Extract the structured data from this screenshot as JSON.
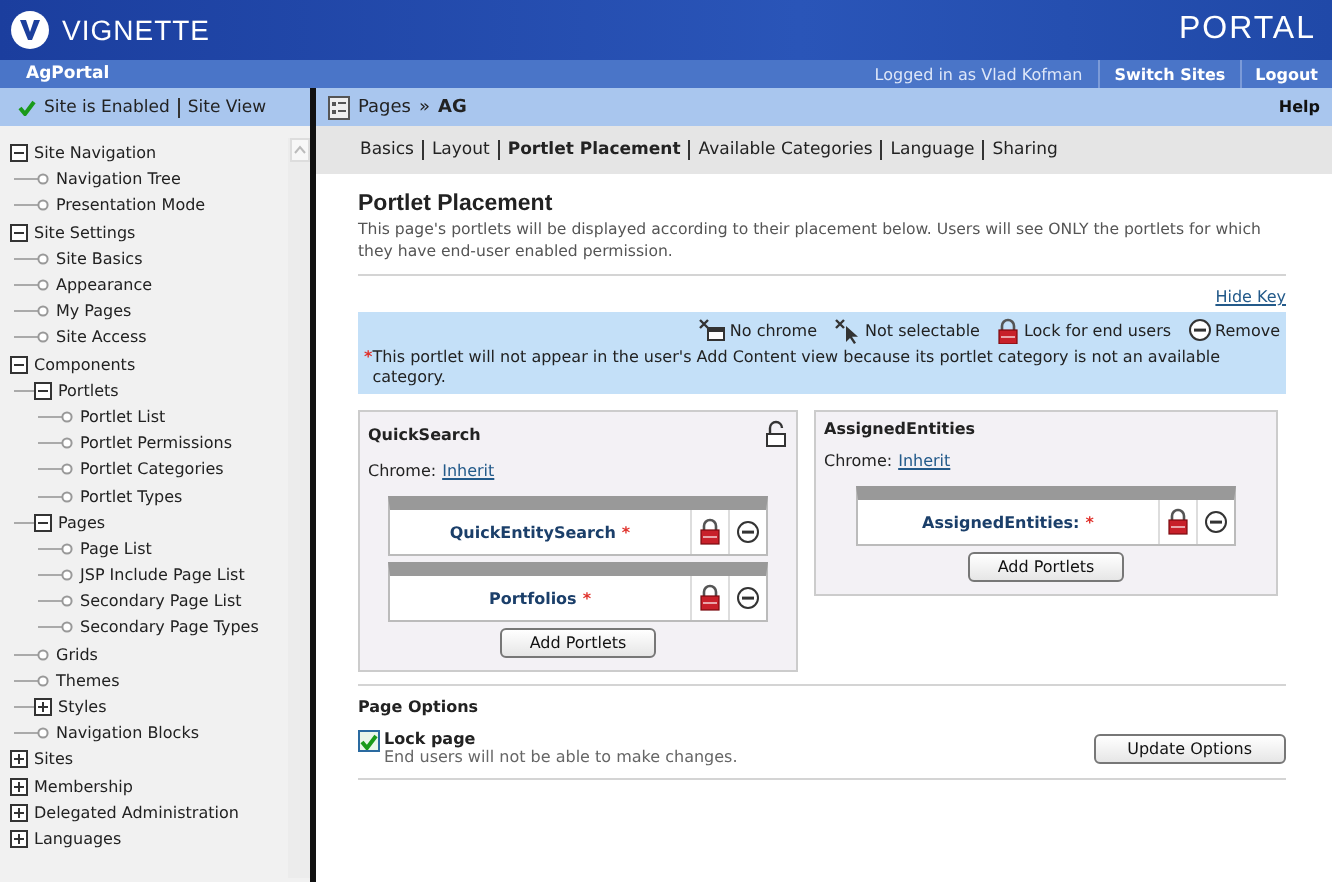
{
  "header": {
    "logo_text": "VIGNETTE",
    "product": "PORTAL"
  },
  "top_bar": {
    "site": "AgPortal",
    "user": "Logged in as Vlad Kofman",
    "links": [
      "Switch Sites",
      "Logout"
    ]
  },
  "site_status": {
    "enabled": true,
    "status": "Site is Enabled",
    "link": "Site View"
  },
  "tree": [
    {
      "label": "Site Navigation",
      "expanded": true,
      "children": [
        {
          "label": "Navigation Tree"
        },
        {
          "label": "Presentation Mode"
        }
      ]
    },
    {
      "label": "Site Settings",
      "expanded": true,
      "children": [
        {
          "label": "Site Basics"
        },
        {
          "label": "Appearance"
        },
        {
          "label": "My Pages"
        },
        {
          "label": "Site Access"
        }
      ]
    },
    {
      "label": "Components",
      "expanded": true,
      "children": [
        {
          "label": "Portlets",
          "expanded": true,
          "children": [
            {
              "label": "Portlet List"
            },
            {
              "label": "Portlet Permissions"
            },
            {
              "label": "Portlet Categories"
            },
            {
              "label": "Portlet Types"
            }
          ]
        },
        {
          "label": "Pages",
          "expanded": true,
          "children": [
            {
              "label": "Page List"
            },
            {
              "label": "JSP Include Page List"
            },
            {
              "label": "Secondary Page List"
            },
            {
              "label": "Secondary Page Types"
            }
          ]
        },
        {
          "label": "Grids"
        },
        {
          "label": "Themes"
        },
        {
          "label": "Styles",
          "expanded": false
        },
        {
          "label": "Navigation Blocks"
        }
      ]
    },
    {
      "label": "Sites",
      "expanded": false
    },
    {
      "label": "Membership",
      "expanded": false
    },
    {
      "label": "Delegated Administration",
      "expanded": false
    },
    {
      "label": "Languages",
      "expanded": false
    }
  ],
  "breadcrumb": {
    "items": [
      "Pages",
      "AG"
    ],
    "separator": "»",
    "help": "Help"
  },
  "tabs": [
    {
      "label": "Basics",
      "selected": false
    },
    {
      "label": "Layout",
      "selected": false
    },
    {
      "label": "Portlet Placement",
      "selected": true
    },
    {
      "label": "Available Categories",
      "selected": false
    },
    {
      "label": "Language",
      "selected": false
    },
    {
      "label": "Sharing",
      "selected": false
    }
  ],
  "content": {
    "title": "Portlet Placement",
    "description": "This page's portlets will be displayed according to their placement below. Users will see ONLY the portlets for which they have end-user enabled permission.",
    "hide_key": "Hide Key",
    "key": {
      "items": [
        {
          "kind": "no-chrome",
          "label": "No chrome"
        },
        {
          "kind": "not-selectable",
          "label": "Not selectable"
        },
        {
          "kind": "lock",
          "label": "Lock for end users"
        },
        {
          "kind": "remove",
          "label": "Remove"
        }
      ],
      "note_mark": "*",
      "note": "This portlet will not appear in the user's Add Content view because its portlet category is not an available category."
    },
    "zones": [
      {
        "title": "QuickSearch",
        "lock_toggle": true,
        "chrome_label": "Chrome:",
        "chrome": "Inherit",
        "portlets": [
          {
            "name": "QuickEntitySearch",
            "mark": "*",
            "locked": true
          },
          {
            "name": "Portfolios",
            "mark": "*",
            "locked": true
          }
        ],
        "button": "Add Portlets"
      },
      {
        "title": "AssignedEntities",
        "lock_toggle": false,
        "chrome_label": "Chrome:",
        "chrome": "Inherit",
        "portlets": [
          {
            "name": "AssignedEntities:",
            "mark": "*",
            "locked": true
          }
        ],
        "button": "Add Portlets"
      }
    ]
  },
  "page_options": {
    "title": "Page Options",
    "lock_page": {
      "label": "Lock page",
      "checked": true,
      "hint": "End users will not be able to make changes."
    },
    "button": "Update Options"
  }
}
